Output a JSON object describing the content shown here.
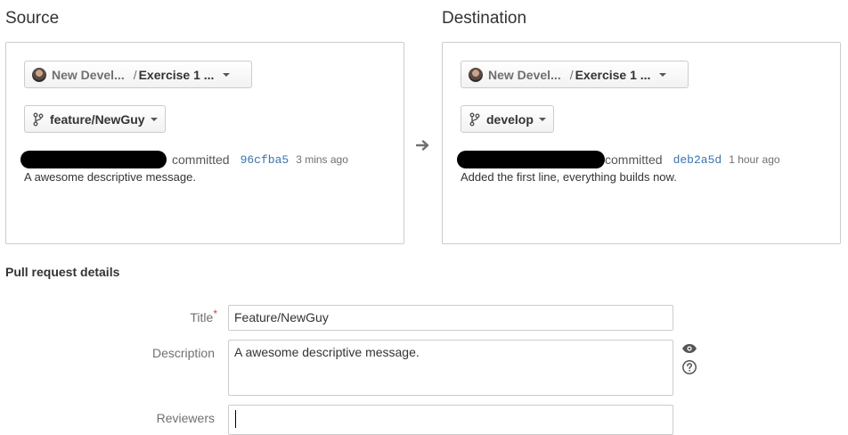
{
  "source": {
    "heading": "Source",
    "project": "New Devel...",
    "repository": "Exercise 1 ...",
    "branch": "feature/NewGuy",
    "committed_label": "committed",
    "commit_hash": "96cfba5",
    "commit_time": "3 mins ago",
    "commit_message": "A awesome descriptive message."
  },
  "destination": {
    "heading": "Destination",
    "project": "New Devel...",
    "repository": "Exercise 1 ...",
    "branch": "develop",
    "committed_label": "committed",
    "commit_hash": "deb2a5d",
    "commit_time": "1 hour ago",
    "commit_message": "Added the first line, everything builds now."
  },
  "details": {
    "heading": "Pull request details",
    "title_label": "Title",
    "required_mark": "*",
    "title_value": "Feature/NewGuy",
    "description_label": "Description",
    "description_value": "A awesome descriptive message.",
    "reviewers_label": "Reviewers",
    "reviewers_value": ""
  },
  "icons": {
    "preview": "eye-icon",
    "help": "question-circle-icon",
    "direction": "arrow-right-icon",
    "branch": "branch-icon"
  },
  "colors": {
    "link": "#3b73af",
    "required": "#d04437",
    "border": "#cccccc"
  }
}
